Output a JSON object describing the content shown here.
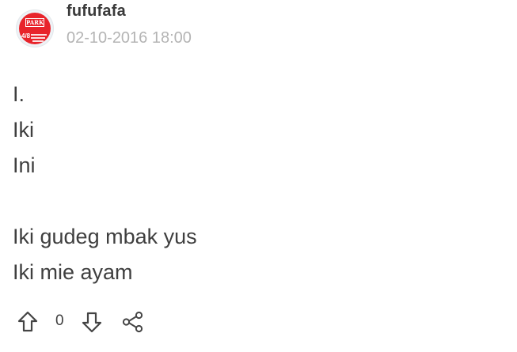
{
  "post": {
    "author": "fufufafa",
    "timestamp": "02-10-2016 18:00",
    "avatar": {
      "icon": "avatar-logo",
      "logo_text": "PARK",
      "date_text": "4/8",
      "colors": {
        "background": "#e8242b",
        "ring": "#eef2f6"
      }
    },
    "body_lines": [
      "I.",
      "Iki",
      "Ini",
      "",
      "Iki gudeg mbak yus",
      "Iki mie ayam"
    ]
  },
  "actions": {
    "upvote_icon": "arrow-up-icon",
    "vote_count": "0",
    "downvote_icon": "arrow-down-icon",
    "share_icon": "share-icon"
  },
  "colors": {
    "text": "#3f3f3f",
    "muted": "#b4b4b4",
    "icon": "#444444"
  }
}
